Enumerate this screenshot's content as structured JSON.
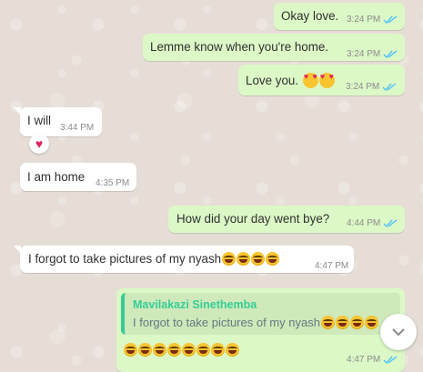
{
  "colors": {
    "outgoing_bubble": "#dcf8c6",
    "incoming_bubble": "#ffffff",
    "read_ticks": "#4fc3f7",
    "quote_author": "#35cd96"
  },
  "messages": [
    {
      "id": "m1",
      "direction": "outgoing",
      "text": "Okay love.",
      "time": "3:24 PM",
      "status": "read"
    },
    {
      "id": "m2",
      "direction": "outgoing",
      "text": "Lemme know when you're home.",
      "time": "3:24 PM",
      "status": "read"
    },
    {
      "id": "m3",
      "direction": "outgoing",
      "text": "Love you.",
      "emoji": [
        "smiling-face-with-hearts",
        "smiling-face-with-hearts"
      ],
      "time": "3:24 PM",
      "status": "read"
    },
    {
      "id": "m4",
      "direction": "incoming",
      "text": "I will",
      "time": "3:44 PM",
      "reaction": "red-heart"
    },
    {
      "id": "m5",
      "direction": "incoming",
      "text": "I am home",
      "time": "4:35 PM"
    },
    {
      "id": "m6",
      "direction": "outgoing",
      "text": "How did your day went bye?",
      "time": "4:44 PM",
      "status": "read"
    },
    {
      "id": "m7",
      "direction": "incoming",
      "text": "I forgot to take pictures of my nyash",
      "emoji": [
        "face-with-tears-of-joy",
        "face-with-tears-of-joy",
        "face-with-tears-of-joy",
        "face-with-tears-of-joy"
      ],
      "time": "4:47 PM"
    },
    {
      "id": "m8",
      "direction": "outgoing",
      "quoted": {
        "author": "Mavilakazi Sinethemba",
        "text": "I forgot to take pictures of my nyash"
      },
      "emoji": [
        "rolling-on-the-floor-laughing",
        "rolling-on-the-floor-laughing",
        "rolling-on-the-floor-laughing",
        "rolling-on-the-floor-laughing",
        "rolling-on-the-floor-laughing",
        "rolling-on-the-floor-laughing",
        "rolling-on-the-floor-laughing",
        "rolling-on-the-floor-laughing"
      ],
      "time": "4:47 PM",
      "status": "read"
    }
  ],
  "scroll_button": {
    "icon": "chevron-down-icon"
  }
}
